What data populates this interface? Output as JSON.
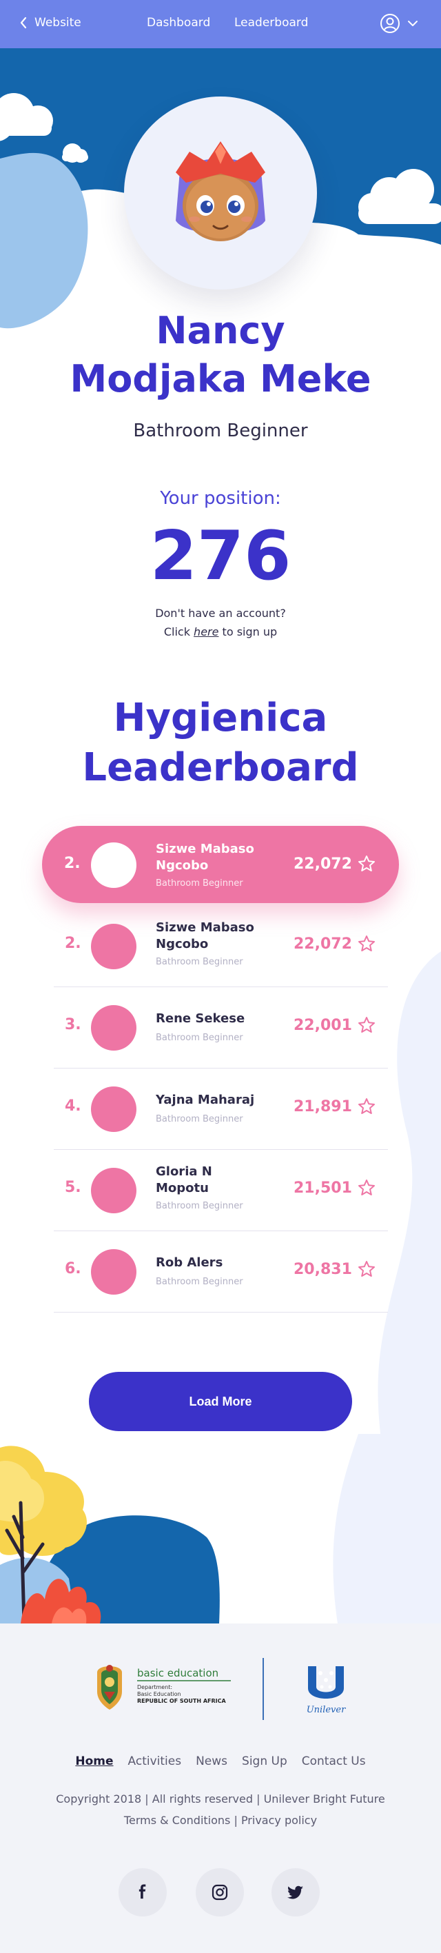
{
  "nav": {
    "back_label": "Website",
    "links": [
      "Dashboard",
      "Leaderboard"
    ]
  },
  "profile": {
    "name_line1": "Nancy",
    "name_line2": "Modjaka Meke",
    "title": "Bathroom Beginner",
    "position_label": "Your position:",
    "position_value": "276",
    "signup_text1": "Don't have an account?",
    "signup_prefix": "Click ",
    "signup_link": "here",
    "signup_suffix": " to sign up"
  },
  "leaderboard": {
    "title_line1": "Hygienica",
    "title_line2": "Leaderboard",
    "current": {
      "rank": "2.",
      "name": "Sizwe Mabaso Ngcobo",
      "subtitle": "Bathroom Beginner",
      "score": "22,072"
    },
    "rows": [
      {
        "rank": "2.",
        "name": "Sizwe Mabaso Ngcobo",
        "subtitle": "Bathroom Beginner",
        "score": "22,072"
      },
      {
        "rank": "3.",
        "name": "Rene Sekese",
        "subtitle": "Bathroom Beginner",
        "score": "22,001"
      },
      {
        "rank": "4.",
        "name": "Yajna Maharaj",
        "subtitle": "Bathroom Beginner",
        "score": "21,891"
      },
      {
        "rank": "5.",
        "name": "Gloria N Mopotu",
        "subtitle": "Bathroom Beginner",
        "score": "21,501"
      },
      {
        "rank": "6.",
        "name": "Rob Alers",
        "subtitle": "Bathroom Beginner",
        "score": "20,831"
      }
    ],
    "load_more": "Load More"
  },
  "footer": {
    "dbe": {
      "name": "basic education",
      "dept": "Department:",
      "sub": "Basic Education",
      "country": "REPUBLIC OF SOUTH AFRICA"
    },
    "unilever": "Unilever",
    "nav": [
      "Home",
      "Activities",
      "News",
      "Sign Up",
      "Contact Us"
    ],
    "copyright": "Copyright 2018 | All rights reserved | Unilever Bright Future",
    "terms": "Terms & Conditions",
    "separator": " | ",
    "privacy": "Privacy policy",
    "social_icons": [
      "facebook-icon",
      "instagram-icon",
      "twitter-icon"
    ]
  },
  "colors": {
    "brand_purple": "#3b32c9",
    "nav_blue": "#6d83e9",
    "pink": "#ee75a4",
    "deep_blue": "#1466ac"
  }
}
